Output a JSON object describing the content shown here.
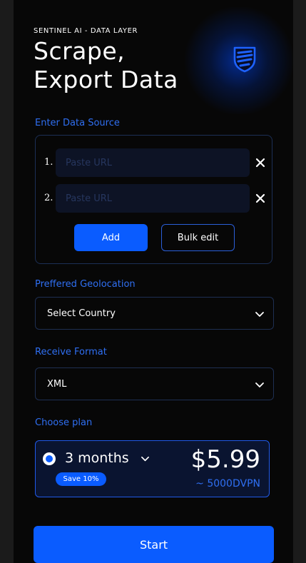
{
  "header": {
    "kicker": "SENTINEL AI - DATA LAYER",
    "title_line1": "Scrape,",
    "title_line2": "Export Data",
    "logo_icon": "shield-icon"
  },
  "source": {
    "label": "Enter Data Source",
    "rows": [
      {
        "number": "1.",
        "placeholder": "Paste URL",
        "value": ""
      },
      {
        "number": "2.",
        "placeholder": "Paste URL",
        "value": ""
      }
    ],
    "remove_icon": "close-icon",
    "add_label": "Add",
    "bulk_label": "Bulk edit"
  },
  "geolocation": {
    "label": "Preffered Geolocation",
    "selected": "Select Country"
  },
  "format": {
    "label": "Receive Format",
    "selected": "XML"
  },
  "plan": {
    "label": "Choose plan",
    "duration": "3 months",
    "badge": "Save 10%",
    "price": "$5.99",
    "price_alt": "~ 5000DVPN"
  },
  "start_label": "Start",
  "colors": {
    "accent": "#0a5cff",
    "label_blue": "#2f6ff2",
    "background": "#070707"
  }
}
